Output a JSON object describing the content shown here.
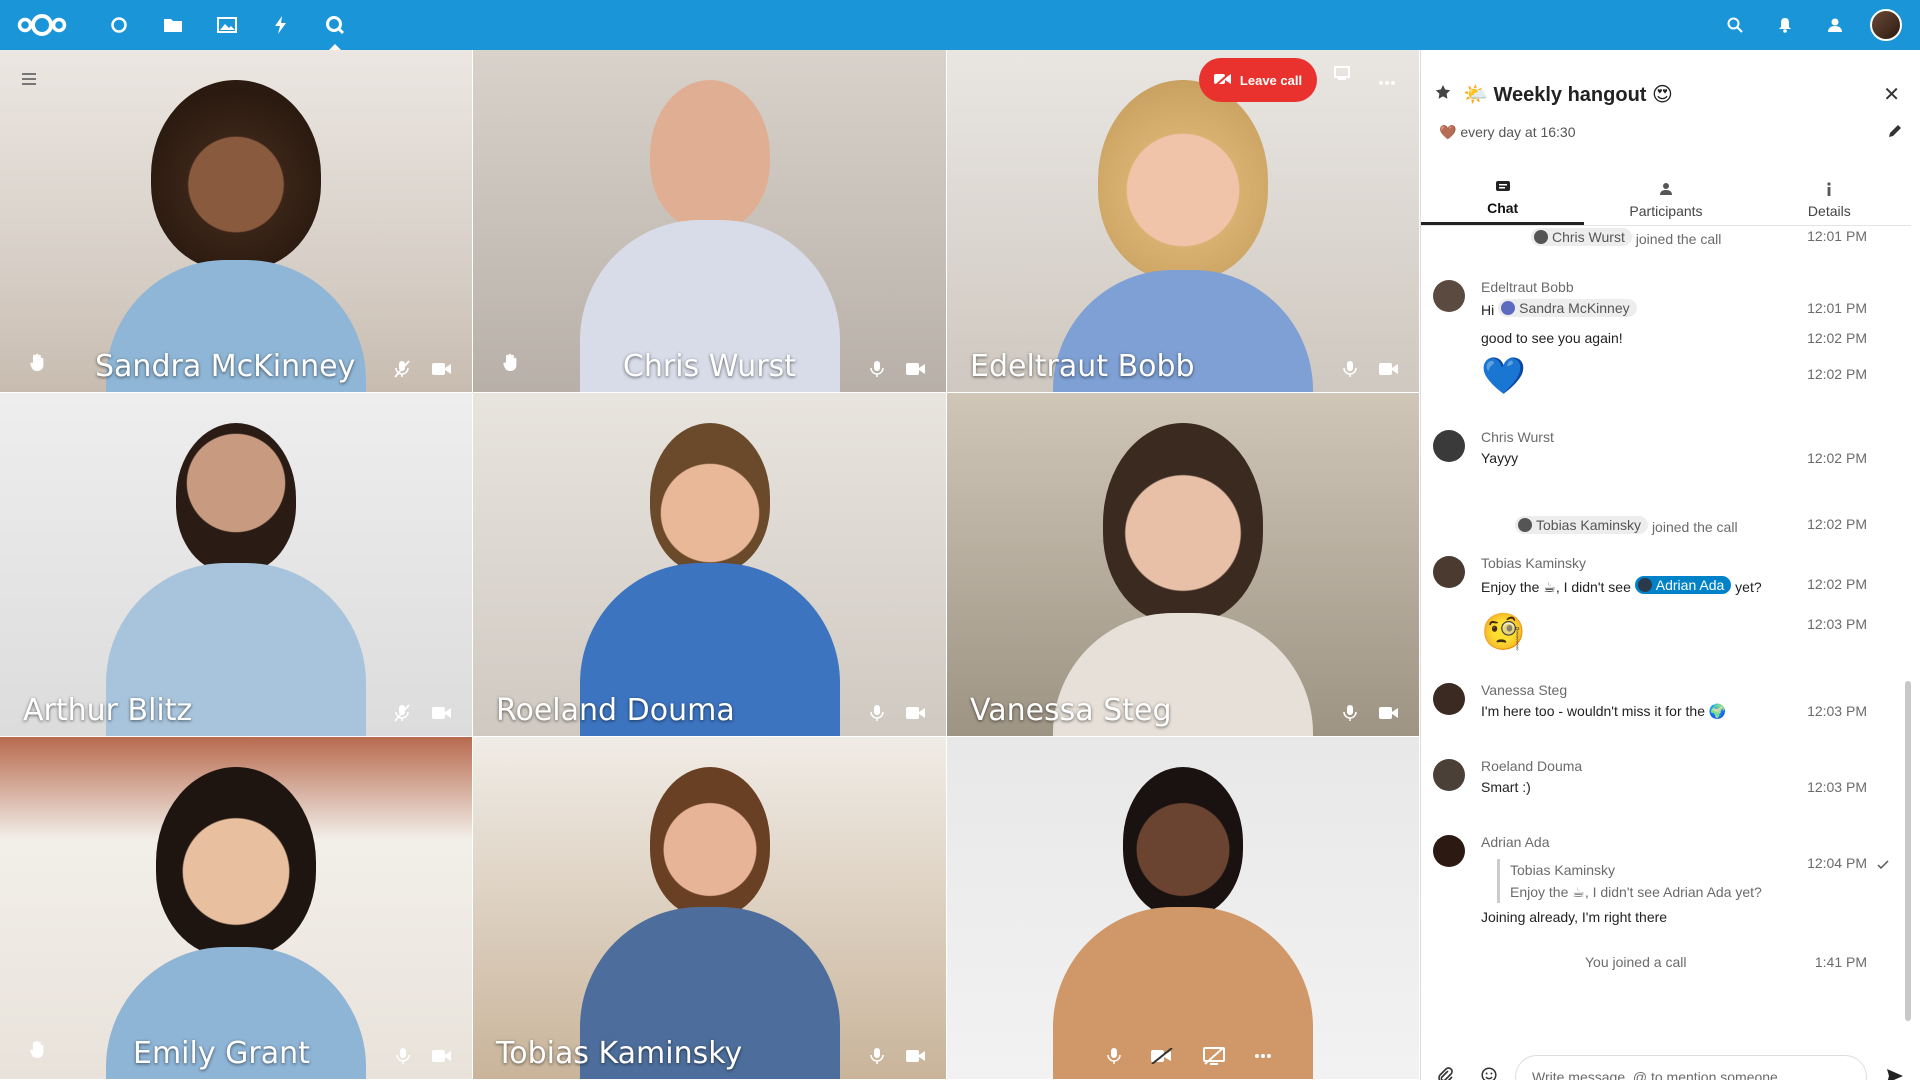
{
  "header": {
    "app_icons": [
      "dashboard-icon",
      "files-icon",
      "photos-icon",
      "activity-icon",
      "talk-icon"
    ],
    "right_icons": [
      "search-icon",
      "notifications-icon",
      "contacts-icon"
    ],
    "brand_color": "#1a96d8"
  },
  "call": {
    "leave_label": "Leave call",
    "tiles": [
      {
        "name": "Sandra McKinney"
      },
      {
        "name": "Chris Wurst"
      },
      {
        "name": "Edeltraut Bobb"
      },
      {
        "name": "Arthur Blitz"
      },
      {
        "name": "Roeland Douma"
      },
      {
        "name": "Vanessa Steg"
      },
      {
        "name": "Emily Grant"
      },
      {
        "name": "Tobias Kaminsky"
      },
      {
        "name": ""
      }
    ]
  },
  "sidebar": {
    "title": "🌤️ Weekly hangout 😍",
    "subtitle": "🤎 every day at 16:30",
    "tabs": {
      "chat": "Chat",
      "participants": "Participants",
      "details": "Details"
    },
    "messages": {
      "sys1_name": "Chris Wurst",
      "sys1_text": "joined the call",
      "sys1_time": "12:01 PM",
      "m1_author": "Edeltraut Bobb",
      "m1_pre": "Hi",
      "m1_mention": "Sandra McKinney",
      "m1_time": "12:01 PM",
      "m2_text": "good to see you again!",
      "m2_time": "12:02 PM",
      "m3_emoji": "💙",
      "m3_time": "12:02 PM",
      "m4_author": "Chris Wurst",
      "m4_text": "Yayyy",
      "m4_time": "12:02 PM",
      "sys2_name": "Tobias Kaminsky",
      "sys2_text": "joined the call",
      "sys2_time": "12:02 PM",
      "m5_author": "Tobias Kaminsky",
      "m5_pre": "Enjoy the ☕, I didn't see",
      "m5_mention": "Adrian Ada",
      "m5_post": "yet?",
      "m5_time": "12:02 PM",
      "m6_emoji": "🧐",
      "m6_time": "12:03 PM",
      "m7_author": "Vanessa Steg",
      "m7_text": "I'm here too - wouldn't miss it for the 🌍",
      "m7_time": "12:03 PM",
      "m8_author": "Roeland Douma",
      "m8_text": "Smart :)",
      "m8_time": "12:03 PM",
      "m9_author": "Adrian Ada",
      "m9_quote_author": "Tobias Kaminsky",
      "m9_quote_text": "Enjoy the ☕, I didn't see Adrian Ada yet?",
      "m9_text": "Joining already, I'm right there",
      "m9_time": "12:04 PM",
      "sys3_text": "You joined a call",
      "sys3_time": "1:41 PM"
    },
    "composer_placeholder": "Write message, @ to mention someone …"
  }
}
